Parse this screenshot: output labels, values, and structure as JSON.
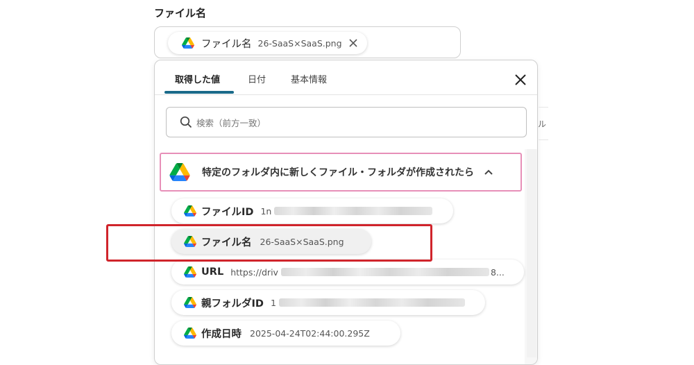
{
  "field": {
    "label": "ファイル名",
    "selected_chip": {
      "name": "ファイル名",
      "value": "26-SaaS×SaaS.png",
      "icon": "google-drive-icon"
    }
  },
  "popup": {
    "tabs": [
      {
        "label": "取得した値",
        "active": true
      },
      {
        "label": "日付",
        "active": false
      },
      {
        "label": "基本情報",
        "active": false
      }
    ],
    "search_placeholder": "検索（前方一致）",
    "trigger": {
      "label": "特定のフォルダ内に新しくファイル・フォルダが作成されたら",
      "icon": "google-drive-icon"
    },
    "items": [
      {
        "name": "ファイルID",
        "value": "1n"
      },
      {
        "name": "ファイル名",
        "value": "26-SaaS×SaaS.png"
      },
      {
        "name": "URL",
        "value": "https://driv",
        "suffix": "8..."
      },
      {
        "name": "親フォルダID",
        "value": "1"
      },
      {
        "name": "作成日時",
        "value": "2025-04-24T02:44:00.295Z"
      }
    ]
  },
  "behind_text": "ル",
  "colors": {
    "tab_active": "#1a6a8a",
    "trigger_border": "#e78fb8",
    "highlight": "#d0242b"
  }
}
